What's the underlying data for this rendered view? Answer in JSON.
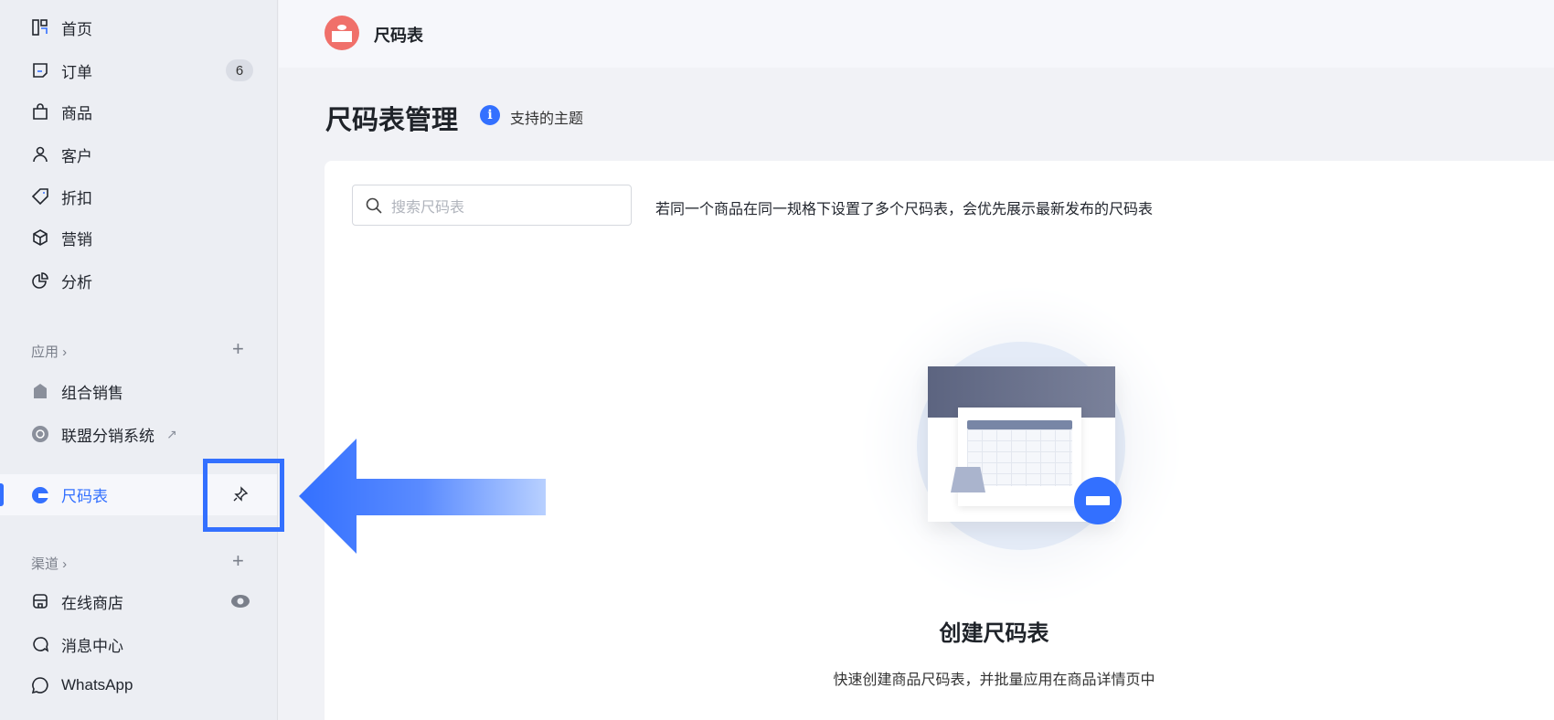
{
  "sidebar": {
    "items": [
      {
        "label": "首页",
        "icon": "home-icon"
      },
      {
        "label": "订单",
        "icon": "order-icon",
        "badge": "6"
      },
      {
        "label": "商品",
        "icon": "bag-icon"
      },
      {
        "label": "客户",
        "icon": "user-icon"
      },
      {
        "label": "折扣",
        "icon": "tag-icon"
      },
      {
        "label": "营销",
        "icon": "cube-icon"
      },
      {
        "label": "分析",
        "icon": "pie-icon"
      }
    ],
    "apps_section": "应用",
    "apps": [
      {
        "label": "组合销售"
      },
      {
        "label": "联盟分销系统"
      }
    ],
    "active_app": "尺码表",
    "channels_section": "渠道",
    "channels": [
      {
        "label": "在线商店"
      },
      {
        "label": "消息中心"
      },
      {
        "label": "WhatsApp"
      }
    ]
  },
  "header": {
    "app_name": "尺码表"
  },
  "page": {
    "title": "尺码表管理",
    "supported_themes": "支持的主题",
    "search_placeholder": "搜索尺码表",
    "hint": "若同一个商品在同一规格下设置了多个尺码表，会优先展示最新发布的尺码表",
    "empty_title": "创建尺码表",
    "empty_desc": "快速创建商品尺码表，并批量应用在商品详情页中"
  },
  "colors": {
    "accent": "#3370ff",
    "sidebar_bg": "#eceef3",
    "logo": "#f0706a"
  }
}
